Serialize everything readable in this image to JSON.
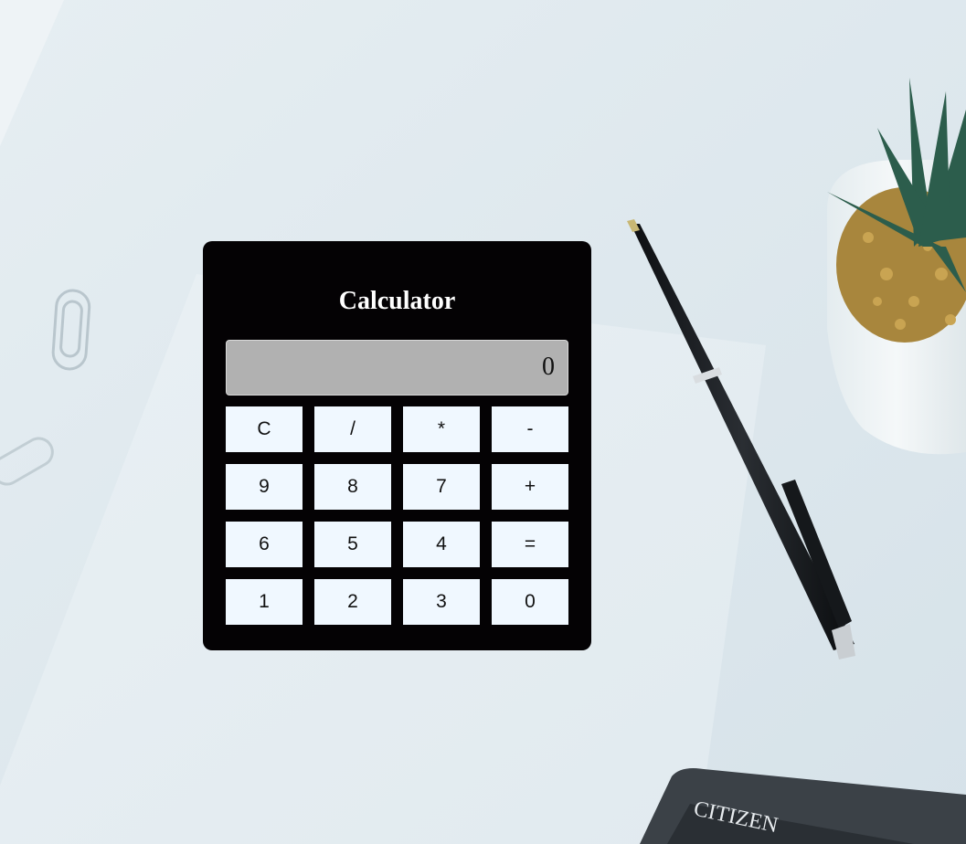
{
  "calculator": {
    "title": "Calculator",
    "display_value": "0",
    "keys": [
      [
        "C",
        "/",
        "*",
        "-"
      ],
      [
        "9",
        "8",
        "7",
        "+"
      ],
      [
        "6",
        "5",
        "4",
        "="
      ],
      [
        "1",
        "2",
        "3",
        "0"
      ]
    ]
  },
  "background": {
    "calculator_brand_text": "CITIZEN"
  },
  "colors": {
    "panel": "#040204",
    "display": "#b1b1b1",
    "key": "#f0f8ff",
    "title_text": "#ffffff"
  }
}
